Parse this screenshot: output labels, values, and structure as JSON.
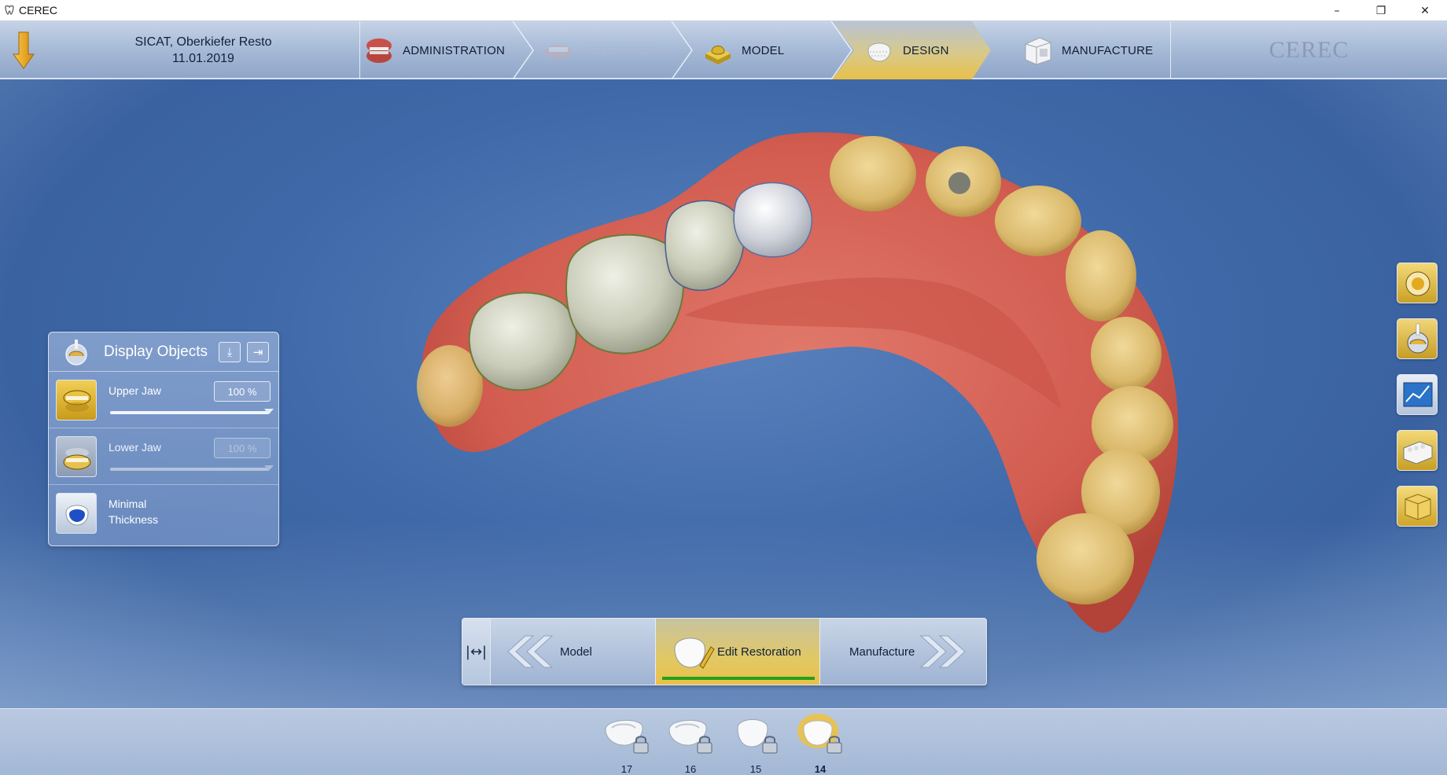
{
  "window": {
    "title": "CEREC",
    "controls": {
      "minimize": "–",
      "restore": "❐",
      "close": "✕"
    }
  },
  "patient": {
    "name": "SICAT, Oberkiefer Resto",
    "date": "11.01.2019"
  },
  "workflow": {
    "steps": [
      {
        "label": "ADMINISTRATION",
        "state": "normal"
      },
      {
        "label": "ACQUISITION",
        "state": "disabled"
      },
      {
        "label": "MODEL",
        "state": "normal"
      },
      {
        "label": "DESIGN",
        "state": "active"
      },
      {
        "label": "MANUFACTURE",
        "state": "normal"
      }
    ],
    "logo": "CEREC"
  },
  "display_objects": {
    "title": "Display Objects",
    "rows": [
      {
        "label": "Upper Jaw",
        "value": "100 %",
        "level_percent": 100
      },
      {
        "label": "Lower Jaw",
        "value": "100 %",
        "level_percent": 100
      },
      {
        "label_line1": "Minimal",
        "label_line2": "Thickness"
      }
    ]
  },
  "phase_bar": {
    "toggle_symbol": "|↔|",
    "back_label": "Model",
    "current_label": "Edit Restoration",
    "next_label": "Manufacture"
  },
  "teeth": [
    {
      "number": "17",
      "locked": true
    },
    {
      "number": "16",
      "locked": true
    },
    {
      "number": "15",
      "locked": true
    },
    {
      "number": "14",
      "locked": true,
      "active": true
    }
  ],
  "colors": {
    "viewport_blue": "#3f69a8",
    "accent_gold": "#e8c04a",
    "progress_green": "#22a11c"
  }
}
